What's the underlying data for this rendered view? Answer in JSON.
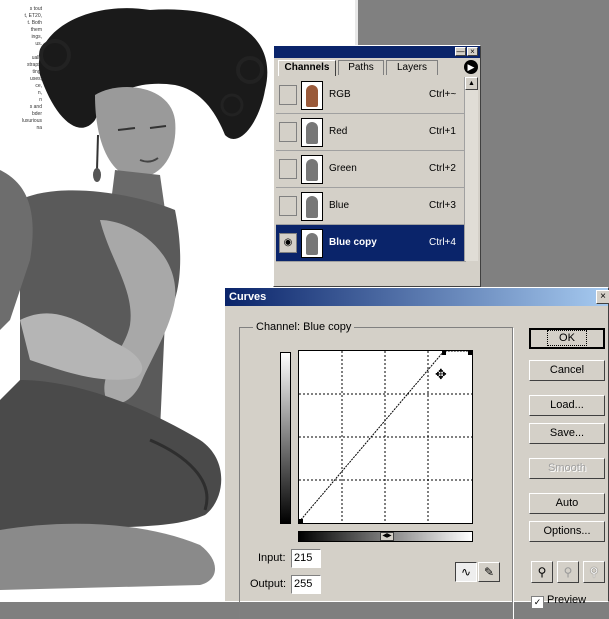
{
  "photo": {
    "sidebar_text": "s tout\nt, ET20,\nt. Both\nthem\nings,\nus.\n\nually\nstraps,\nting,\nuses,\nce,\nn,\nn\ns and\nbder\nluxurious\nna"
  },
  "channels": {
    "tabs": [
      "Channels",
      "Paths",
      "Layers"
    ],
    "active_tab": "Channels",
    "rows": [
      {
        "name": "RGB",
        "shortcut": "Ctrl+~",
        "visible": false,
        "selected": false
      },
      {
        "name": "Red",
        "shortcut": "Ctrl+1",
        "visible": false,
        "selected": false
      },
      {
        "name": "Green",
        "shortcut": "Ctrl+2",
        "visible": false,
        "selected": false
      },
      {
        "name": "Blue",
        "shortcut": "Ctrl+3",
        "visible": false,
        "selected": false
      },
      {
        "name": "Blue copy",
        "shortcut": "Ctrl+4",
        "visible": true,
        "selected": true
      }
    ],
    "selection_color": "#0a246a"
  },
  "curves": {
    "title": "Curves",
    "channel_label": "Channel:",
    "channel_value": "Blue copy",
    "input_label": "Input:",
    "input_value": "215",
    "output_label": "Output:",
    "output_value": "255",
    "buttons": {
      "ok": "OK",
      "cancel": "Cancel",
      "load": "Load...",
      "save": "Save...",
      "smooth": "Smooth",
      "auto": "Auto",
      "options": "Options..."
    },
    "preview_label": "Preview",
    "preview_checked": true,
    "curve_points": [
      [
        0,
        0
      ],
      [
        215,
        255
      ],
      [
        255,
        255
      ]
    ]
  }
}
